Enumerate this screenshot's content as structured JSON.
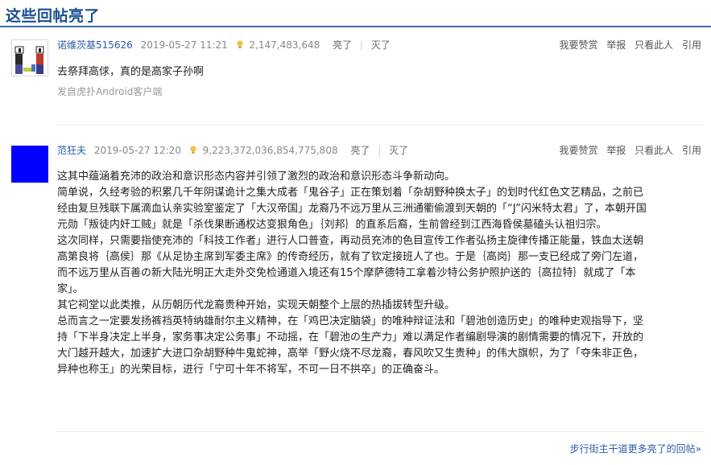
{
  "header": {
    "title": "这些回帖亮了"
  },
  "actions": [
    "我要赞赏",
    "举报",
    "只看此人",
    "引用"
  ],
  "posts": [
    {
      "author": "诺维茨基515626",
      "datetime": "2019-05-27 11:21",
      "light_count": "2,147,483,648",
      "liang": "亮了",
      "mie": "灭了",
      "content": [
        "去祭拜高俅，真的是高家子孙啊"
      ],
      "source": "发自虎扑Android客户端"
    },
    {
      "author": "范狂夫",
      "datetime": "2019-05-27 12:20",
      "light_count": "9,223,372,036,854,775,808",
      "liang": "亮了",
      "mie": "灭了",
      "content": [
        "这其中蕴涵着充沛的政治和意识形态内容并引领了激烈的政治和意识形态斗争新动向。",
        "简单说，久经考验的积累几千年阴谋诡计之集大成者「鬼谷子」正在策划着「杂胡野种换太子」的划时代红色文艺精品，之前已",
        "经由复旦残联下属滴血认亲实验室鉴定了「大汉帝国」龙裔乃不远万里从三洲通衢偷渡到天朝的「“J”闪米特太君」了，本朝开国",
        "元勋「叛徒内奸工贼」就是「杀伐果断通权达变狠角色」｛刘邦｝的直系后裔，生前曾经到江西海昏侯墓磕头认祖归宗。",
        "这次同样，只需要指使充沛的「科技工作者」进行人口普查，再动员充沛的色目宣传工作者弘扬主旋律传播正能量，铁血太送朝",
        "高第良将｛高侯｝那《从足协主席到军委主席》的传奇经历，就有了钦定接班人了也。于是｛高岗｝那一支已经成了旁门左道，",
        "而不远万里从百善の新大陆光明正大走外交免检通道入境还有15个摩萨德特工拿着沙特公务护照护送的｛高拉特｝就成了「本",
        "家」。",
        "其它祠堂以此类推，从历朝历代龙裔贵种开始，实现天朝整个上层的热插拔转型升级。",
        "总而言之一定要发扬裤裆英特纳雄耐尔主义精神，在「鸡巴决定脑袋」的唯种辩证法和「碧池创造历史」的唯种史观指导下，坚",
        "持「下半身决定上半身，家务事决定公务事」不动摇，在「碧池の生产力」难以满足作者编剧导演的剧情需要的情况下，开放的",
        "大门越开越大，加速扩大进口杂胡野种牛鬼蛇神，高举「野火烧不尽龙裔，春风吹又生贵种」的伟大旗帜，为了「夺朱非正色，",
        "异种也称王」的光荣目标，进行「宁可十年不将军，不可一日不拱卒」的正确奋斗。"
      ]
    }
  ],
  "footer": {
    "link": "步行街主干道更多亮了的回帖»"
  },
  "colors": {
    "accent": "#1a4f94",
    "link": "#2a5ca8",
    "avatar2": "#0000ff"
  },
  "icons": {
    "light": "lightbulb-icon"
  }
}
